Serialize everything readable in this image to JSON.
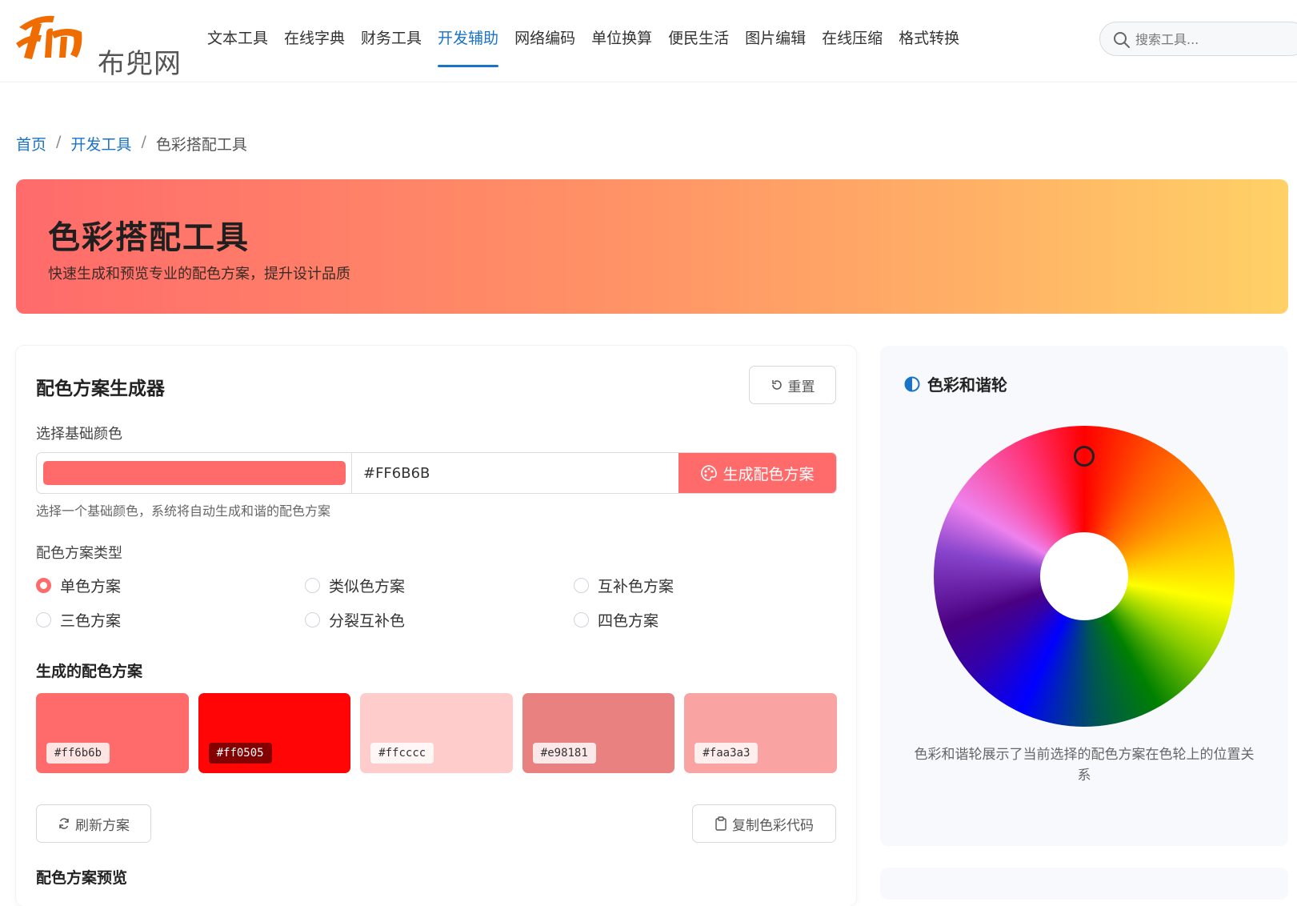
{
  "brand": {
    "name": "布兜网",
    "accent": "#1a73c8",
    "logo_color": "#ef6c00"
  },
  "nav": {
    "items": [
      {
        "label": "文本工具"
      },
      {
        "label": "在线字典"
      },
      {
        "label": "财务工具"
      },
      {
        "label": "开发辅助",
        "active": true
      },
      {
        "label": "网络编码"
      },
      {
        "label": "单位换算"
      },
      {
        "label": "便民生活"
      },
      {
        "label": "图片编辑"
      },
      {
        "label": "在线压缩"
      },
      {
        "label": "格式转换"
      }
    ]
  },
  "search": {
    "placeholder": "搜索工具...",
    "icon": "search-icon"
  },
  "breadcrumb": {
    "home": "首页",
    "sep": "/",
    "parent": "开发工具",
    "current": "色彩搭配工具"
  },
  "banner": {
    "title": "色彩搭配工具",
    "subtitle": "快速生成和预览专业的配色方案，提升设计品质"
  },
  "generator": {
    "title": "配色方案生成器",
    "reset_label": "重置",
    "base_color_label": "选择基础颜色",
    "base_color": "#ff6b6b",
    "hex_value": "#FF6B6B",
    "generate_label": "生成配色方案",
    "hint": "选择一个基础颜色，系统将自动生成和谐的配色方案",
    "scheme_type_label": "配色方案类型",
    "scheme_types": [
      {
        "label": "单色方案",
        "checked": true
      },
      {
        "label": "类似色方案",
        "checked": false
      },
      {
        "label": "互补色方案",
        "checked": false
      },
      {
        "label": "三色方案",
        "checked": false
      },
      {
        "label": "分裂互补色",
        "checked": false
      },
      {
        "label": "四色方案",
        "checked": false
      }
    ],
    "result_title": "生成的配色方案",
    "palette": [
      {
        "hex": "#ff6b6b",
        "label": "#ff6b6b"
      },
      {
        "hex": "#ff0505",
        "label": "#ff0505"
      },
      {
        "hex": "#ffcccc",
        "label": "#ffcccc"
      },
      {
        "hex": "#e98181",
        "label": "#e98181"
      },
      {
        "hex": "#faa3a3",
        "label": "#faa3a3"
      }
    ],
    "refresh_label": "刷新方案",
    "copy_label": "复制色彩代码",
    "preview_title": "配色方案预览"
  },
  "wheel": {
    "title": "色彩和谐轮",
    "description": "色彩和谐轮展示了当前选择的配色方案在色轮上的位置关系"
  }
}
